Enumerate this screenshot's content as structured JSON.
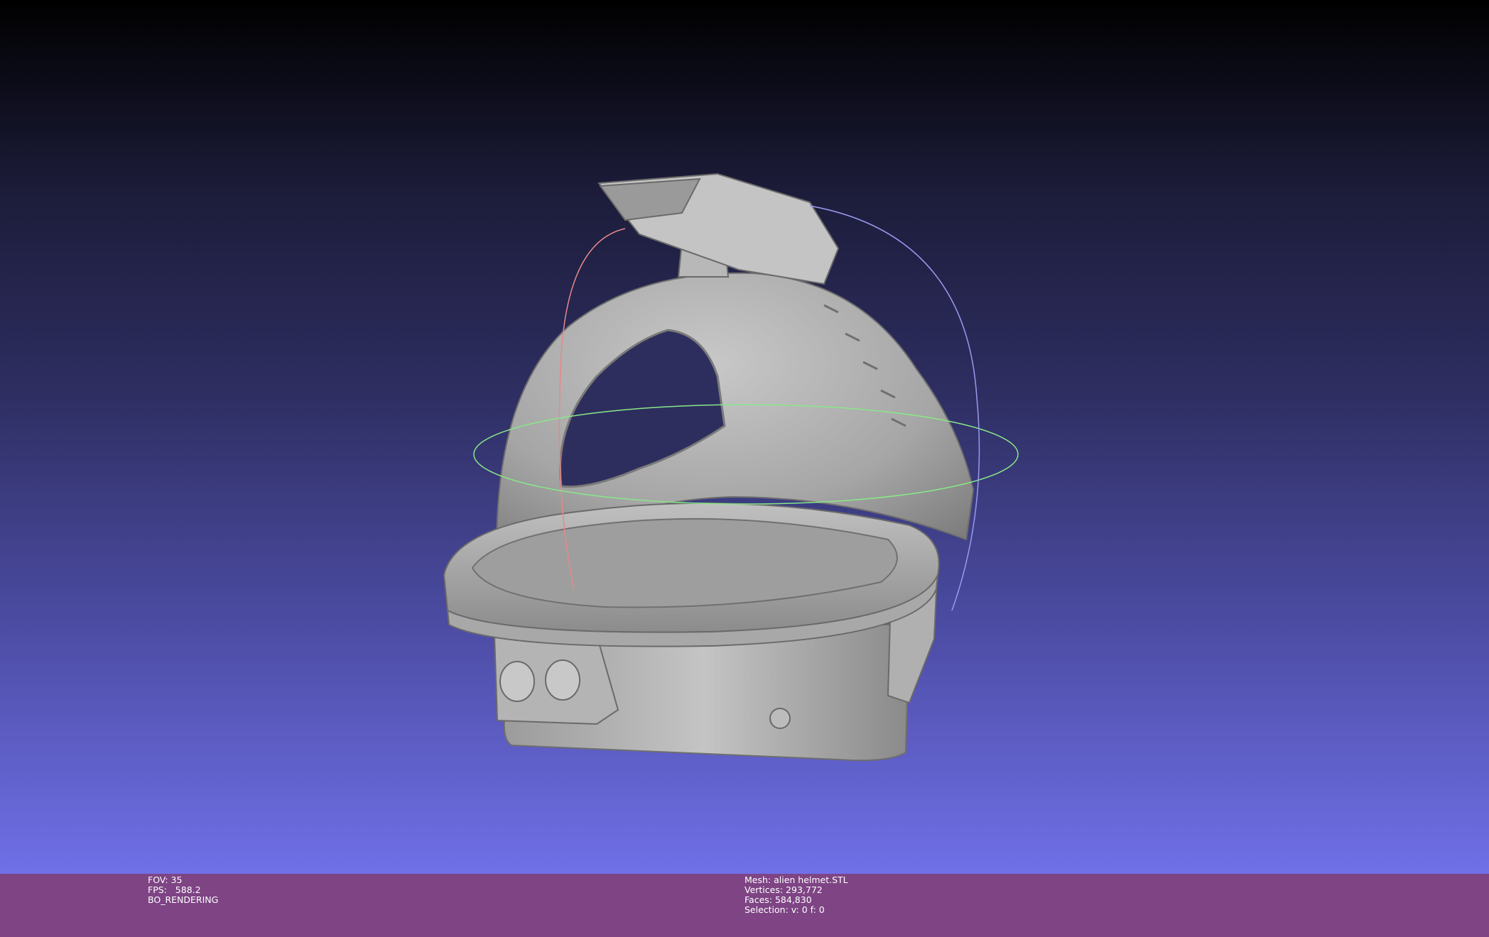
{
  "viewer": {
    "background_top": "#000000",
    "background_bottom": "#7070e8",
    "statusbar_color": "#7e4484",
    "trackball": {
      "x_ring": "#e88888",
      "y_ring": "#88e888",
      "z_ring": "#9999ee"
    },
    "model_color": "#a8a8a8"
  },
  "status": {
    "fov": "FOV: 35",
    "fps": "FPS:   588.2",
    "render_mode": "BO_RENDERING",
    "mesh": "Mesh: alien helmet.STL",
    "vertices": "Vertices: 293,772",
    "faces": "Faces: 584,830",
    "selection": "Selection: v: 0 f: 0"
  }
}
